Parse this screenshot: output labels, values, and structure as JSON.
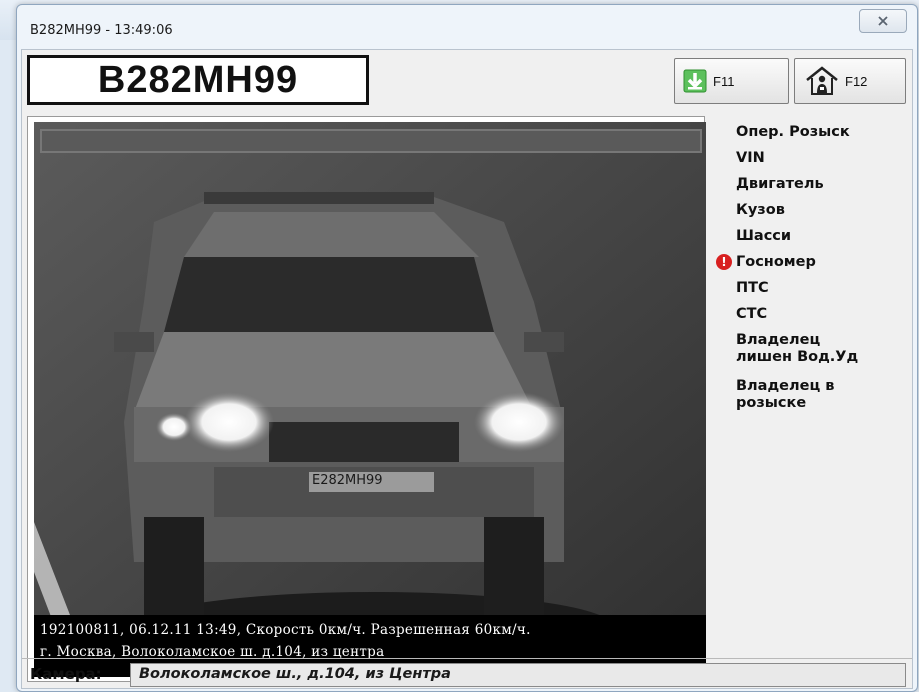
{
  "window": {
    "title": "B282MH99 - 13:49:06"
  },
  "plate": {
    "number": "B282MH99"
  },
  "toolbar": {
    "f11_label": "F11",
    "f12_label": "F12"
  },
  "photo": {
    "plate_on_car": "E282MH99",
    "caption_line1": "192100811, 06.12.11  13:49, Скорость   0км/ч. Разрешенная  60км/ч.",
    "caption_line2": "г. Москва, Волоколамское ш. д.104, из центра"
  },
  "checks": [
    {
      "label": "Опер. Розыск"
    },
    {
      "label": "VIN"
    },
    {
      "label": "Двигатель"
    },
    {
      "label": "Кузов"
    },
    {
      "label": "Шасси"
    },
    {
      "label": "Госномер",
      "alert": true
    },
    {
      "label": "ПТС"
    },
    {
      "label": "СТС"
    },
    {
      "label_line1": "Владелец",
      "label_line2": "лишен Вод.Уд"
    },
    {
      "label_line1": "Владелец в",
      "label_line2": "розыске"
    }
  ],
  "camera": {
    "label": "Камера:",
    "value": "Волоколамское ш., д.104, из Центра"
  },
  "colors": {
    "alert": "#d82020",
    "download_arrow": "#3aa63a"
  },
  "icons": {
    "f11": "download-icon",
    "f12": "house-icon",
    "alert": "alert-icon",
    "close": "close-icon"
  }
}
